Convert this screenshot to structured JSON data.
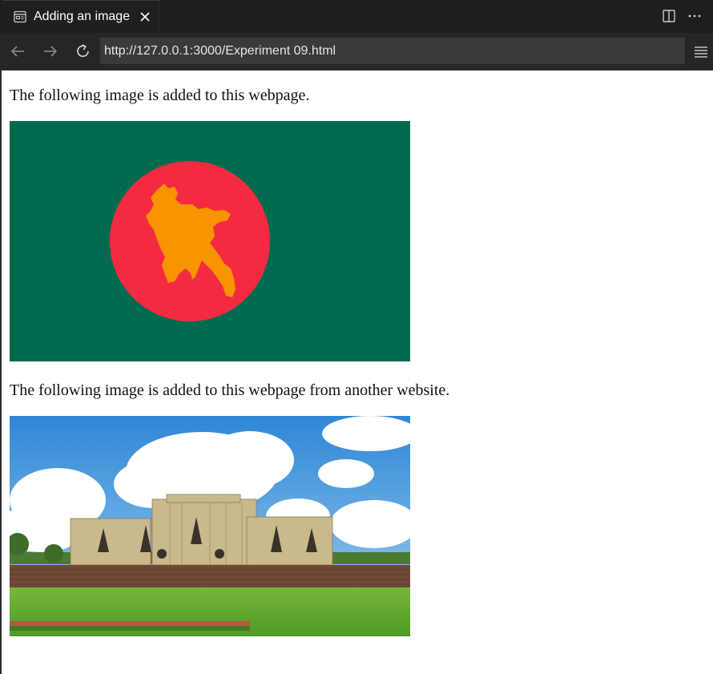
{
  "tab": {
    "title": "Adding an image"
  },
  "nav": {
    "url": "http://127.0.0.1:3000/Experiment 09.html"
  },
  "page": {
    "paragraph1": "The following image is added to this webpage.",
    "paragraph2": "The following image is added to this webpage from another website."
  },
  "icons": {
    "tab": "preview-icon",
    "close": "close-icon",
    "split": "split-editor-icon",
    "more": "more-actions-icon",
    "back": "back-arrow-icon",
    "forward": "forward-arrow-icon",
    "reload": "reload-icon",
    "menu": "menu-icon"
  },
  "colors": {
    "flag_green": "#006a4e",
    "flag_red": "#f42a41",
    "map_orange": "#f79400"
  }
}
